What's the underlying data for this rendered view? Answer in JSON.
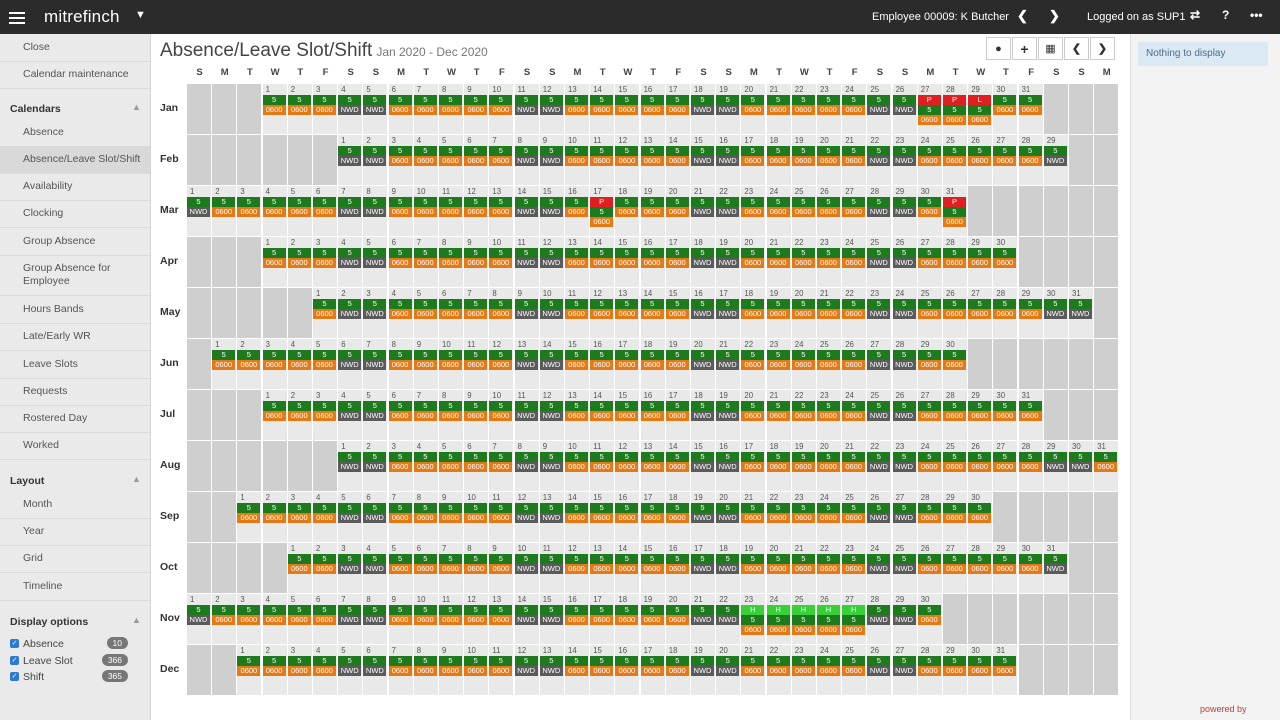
{
  "app": {
    "brand": "mitrefinch",
    "employee": "Employee 00009: K Butcher",
    "logged_on": "Logged on as SUP1",
    "powered": "powered by"
  },
  "page": {
    "title": "Absence/Leave Slot/Shift",
    "range": "Jan 2020 - Dec 2020"
  },
  "sidebar": {
    "top_items": [
      {
        "label": "Close"
      },
      {
        "label": "Calendar maintenance"
      }
    ],
    "calendars_header": "Calendars",
    "calendars": [
      {
        "label": "Absence"
      },
      {
        "label": "Absence/Leave Slot/Shift"
      },
      {
        "label": "Availability"
      },
      {
        "label": "Clocking"
      },
      {
        "label": "Group Absence"
      },
      {
        "label": "Group Absence for Employee"
      },
      {
        "label": "Hours Bands"
      },
      {
        "label": "Late/Early WR"
      },
      {
        "label": "Leave Slots"
      },
      {
        "label": "Requests"
      },
      {
        "label": "Rostered Day"
      },
      {
        "label": "Worked"
      }
    ],
    "layout_header": "Layout",
    "layouts": [
      {
        "label": "Month"
      },
      {
        "label": "Year"
      },
      {
        "label": "Grid"
      },
      {
        "label": "Timeline"
      }
    ],
    "display_header": "Display options",
    "display_options": [
      {
        "label": "Absence",
        "count": "10"
      },
      {
        "label": "Leave Slot",
        "count": "366"
      },
      {
        "label": "Shift",
        "count": "365"
      }
    ]
  },
  "right_panel": {
    "message": "Nothing to display"
  },
  "calendar": {
    "weekday_headers": [
      "S",
      "M",
      "T",
      "W",
      "T",
      "F",
      "S",
      "S",
      "M",
      "T",
      "W",
      "T",
      "F",
      "S",
      "S",
      "M",
      "T",
      "W",
      "T",
      "F",
      "S",
      "S",
      "M",
      "T",
      "W",
      "T",
      "F",
      "S",
      "S",
      "M",
      "T",
      "W",
      "T",
      "F",
      "S",
      "S",
      "M"
    ],
    "months": [
      "Jan",
      "Feb",
      "Mar",
      "Apr",
      "May",
      "Jun",
      "Jul",
      "Aug",
      "Sep",
      "Oct",
      "Nov",
      "Dec"
    ],
    "year": 2020,
    "leave_text": "5",
    "shift_work_text": "0600",
    "shift_off_text": "NWD",
    "absences": [
      {
        "month": 1,
        "day": 27,
        "code": "P"
      },
      {
        "month": 1,
        "day": 28,
        "code": "P"
      },
      {
        "month": 1,
        "day": 29,
        "code": "L"
      },
      {
        "month": 3,
        "day": 17,
        "code": "P"
      },
      {
        "month": 3,
        "day": 31,
        "code": "P"
      },
      {
        "month": 11,
        "day": 23,
        "code": "H"
      },
      {
        "month": 11,
        "day": 24,
        "code": "H"
      },
      {
        "month": 11,
        "day": 25,
        "code": "H"
      },
      {
        "month": 11,
        "day": 26,
        "code": "H"
      },
      {
        "month": 11,
        "day": 27,
        "code": "H"
      }
    ],
    "colors": {
      "leave": "#1d7a1d",
      "absence_p": "#e02020",
      "absence_h": "#37d037",
      "shift_work": "#e47a15",
      "shift_off": "#5b5b5b",
      "pad": "#cfcfcf"
    }
  }
}
